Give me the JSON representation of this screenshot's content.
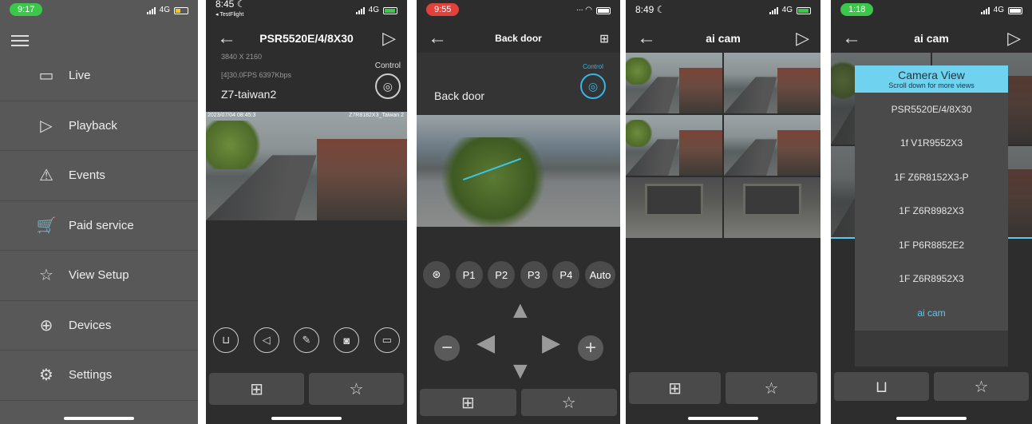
{
  "p1": {
    "time": "9:17",
    "network": "4G",
    "menu": [
      {
        "icon": "live-icon",
        "label": "Live"
      },
      {
        "icon": "playback-icon",
        "label": "Playback"
      },
      {
        "icon": "events-icon",
        "label": "Events"
      },
      {
        "icon": "paid-service-icon",
        "label": "Paid service"
      },
      {
        "icon": "star-icon",
        "label": "View Setup"
      },
      {
        "icon": "devices-icon",
        "label": "Devices"
      },
      {
        "icon": "settings-icon",
        "label": "Settings"
      }
    ]
  },
  "p2": {
    "time": "8:45",
    "back_label": "◂ TestFlight",
    "network": "4G",
    "title": "PSR5520E/4/8X30",
    "resolution": "3840 X 2160",
    "fps": "[4]30.0FPS 6397Kbps",
    "device": "Z7-taiwan2",
    "control_label": "Control",
    "osd_left": "2023/07/04 08:45:3",
    "osd_right": "Z7R8182X3_Taiwan 2"
  },
  "p3": {
    "time": "9:55",
    "title": "Back door",
    "camera_name": "Back door",
    "control_label": "Control",
    "presets": [
      "P1",
      "P2",
      "P3",
      "P4",
      "Auto"
    ]
  },
  "p4": {
    "time": "8:49",
    "network": "4G",
    "title": "ai cam"
  },
  "p5": {
    "time": "1:18",
    "network": "4G",
    "title": "ai cam",
    "overlay_title": "Camera View",
    "overlay_subtitle": "Scroll down for more views",
    "views": [
      "PSR5520E/4/8X30",
      "1f V1R9552X3",
      "1F Z6R8152X3-P",
      "1F Z6R8982X3",
      "1F P6R8852E2",
      "1F Z6R8952X3",
      "ai cam"
    ]
  }
}
